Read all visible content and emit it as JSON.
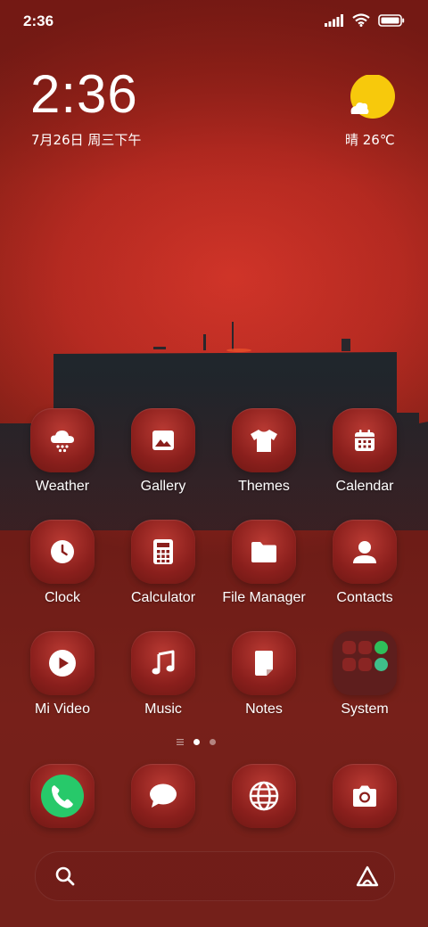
{
  "status_bar": {
    "time": "2:36"
  },
  "clock_widget": {
    "time": "2:36",
    "date": "7月26日 周三下午"
  },
  "weather_widget": {
    "text": "晴 26℃"
  },
  "apps": [
    {
      "label": "Weather",
      "icon": "cloud-snow-icon"
    },
    {
      "label": "Gallery",
      "icon": "image-icon"
    },
    {
      "label": "Themes",
      "icon": "tshirt-icon"
    },
    {
      "label": "Calendar",
      "icon": "calendar-icon"
    },
    {
      "label": "Clock",
      "icon": "clock-icon"
    },
    {
      "label": "Calculator",
      "icon": "calculator-icon"
    },
    {
      "label": "File Manager",
      "icon": "folder-icon"
    },
    {
      "label": "Contacts",
      "icon": "contact-icon"
    },
    {
      "label": "Mi Video",
      "icon": "play-icon"
    },
    {
      "label": "Music",
      "icon": "music-note-icon"
    },
    {
      "label": "Notes",
      "icon": "note-icon"
    },
    {
      "label": "System",
      "icon": "system-folder-icon"
    }
  ],
  "dock": [
    {
      "icon": "phone-icon"
    },
    {
      "icon": "message-icon"
    },
    {
      "icon": "browser-icon"
    },
    {
      "icon": "camera-icon"
    }
  ],
  "page_indicator": {
    "pages": 2,
    "current": 1
  },
  "colors": {
    "phone_green": "#27c96a",
    "sun_yellow": "#f7c90c",
    "tile_red": "#8a1f1c"
  }
}
